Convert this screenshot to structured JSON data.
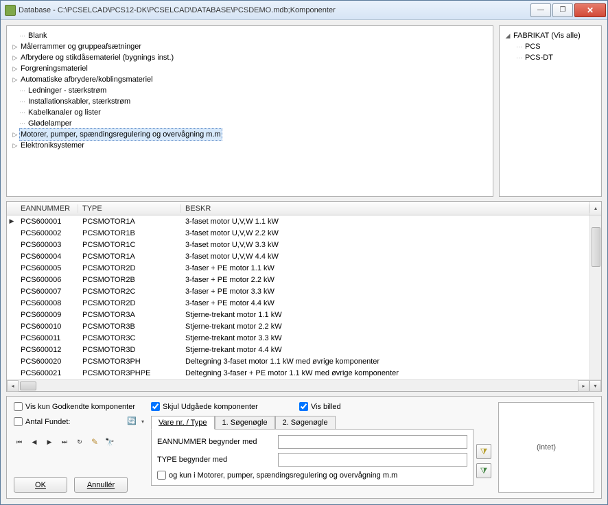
{
  "window": {
    "title": "Database - C:\\PCSELCAD\\PCS12-DK\\PCSELCAD\\DATABASE\\PCSDEMO.mdb;Komponenter"
  },
  "treeLeft": [
    {
      "label": "Blank",
      "expandable": false
    },
    {
      "label": "Målerrammer og gruppeafsætninger",
      "expandable": true
    },
    {
      "label": "Afbrydere og stikdåsemateriel (bygnings inst.)",
      "expandable": true
    },
    {
      "label": "Forgreningsmateriel",
      "expandable": true
    },
    {
      "label": "Automatiske afbrydere/koblingsmateriel",
      "expandable": true
    },
    {
      "label": "Ledninger - stærkstrøm",
      "expandable": false
    },
    {
      "label": "Installationskabler, stærkstrøm",
      "expandable": false
    },
    {
      "label": "Kabelkanaler og lister",
      "expandable": false
    },
    {
      "label": "Glødelamper",
      "expandable": false
    },
    {
      "label": "Motorer, pumper, spændingsregulering og overvågning m.m",
      "expandable": true,
      "selected": true
    },
    {
      "label": "Elektroniksystemer",
      "expandable": true
    }
  ],
  "treeRight": {
    "root": "FABRIKAT (Vis alle)",
    "children": [
      "PCS",
      "PCS-DT"
    ]
  },
  "grid": {
    "headers": {
      "ean": "EANNUMMER",
      "type": "TYPE",
      "beskr": "BESKR"
    },
    "rows": [
      {
        "ean": "PCS600001",
        "type": "PCSMOTOR1A",
        "beskr": "3-faset motor U,V,W 1.1 kW",
        "current": true
      },
      {
        "ean": "PCS600002",
        "type": "PCSMOTOR1B",
        "beskr": "3-faset motor U,V,W 2.2 kW"
      },
      {
        "ean": "PCS600003",
        "type": "PCSMOTOR1C",
        "beskr": "3-faset motor U,V,W 3.3 kW"
      },
      {
        "ean": "PCS600004",
        "type": "PCSMOTOR1A",
        "beskr": "3-faset motor U,V,W 4.4 kW"
      },
      {
        "ean": "PCS600005",
        "type": "PCSMOTOR2D",
        "beskr": "3-faser + PE motor 1.1 kW"
      },
      {
        "ean": "PCS600006",
        "type": "PCSMOTOR2B",
        "beskr": "3-faser + PE motor 2.2 kW"
      },
      {
        "ean": "PCS600007",
        "type": "PCSMOTOR2C",
        "beskr": "3-faser + PE motor 3.3 kW"
      },
      {
        "ean": "PCS600008",
        "type": "PCSMOTOR2D",
        "beskr": "3-faser + PE motor 4.4 kW"
      },
      {
        "ean": "PCS600009",
        "type": "PCSMOTOR3A",
        "beskr": "Stjerne-trekant motor 1.1 kW"
      },
      {
        "ean": "PCS600010",
        "type": "PCSMOTOR3B",
        "beskr": "Stjerne-trekant motor 2.2 kW"
      },
      {
        "ean": "PCS600011",
        "type": "PCSMOTOR3C",
        "beskr": "Stjerne-trekant motor 3.3 kW"
      },
      {
        "ean": "PCS600012",
        "type": "PCSMOTOR3D",
        "beskr": "Stjerne-trekant motor 4.4 kW"
      },
      {
        "ean": "PCS600020",
        "type": "PCSMOTOR3PH",
        "beskr": "Deltegning 3-faset motor 1.1 kW med øvrige komponenter"
      },
      {
        "ean": "PCS600021",
        "type": "PCSMOTOR3PHPE",
        "beskr": "Deltegning 3-faser + PE motor 1.1 kW med øvrige komponenter"
      }
    ]
  },
  "bottom": {
    "vis_kun_godkendte": "Vis kun Godkendte komponenter",
    "antal_fundet": "Antal Fundet:",
    "ok": "OK",
    "annuller": "Annullér",
    "skjul_udgaede": "Skjul Udgåede komponenter",
    "vis_billed": "Vis billed",
    "tabs": {
      "varenr": "Vare nr. / Type",
      "sog1": "1. Søgenøgle",
      "sog2": "2. Søgenøgle"
    },
    "ean_label": "EANNUMMER begynder med",
    "type_label": "TYPE begynder med",
    "og_kun_i": "og kun i Motorer, pumper, spændingsregulering og overvågning m.m",
    "intet": "(intet)"
  }
}
